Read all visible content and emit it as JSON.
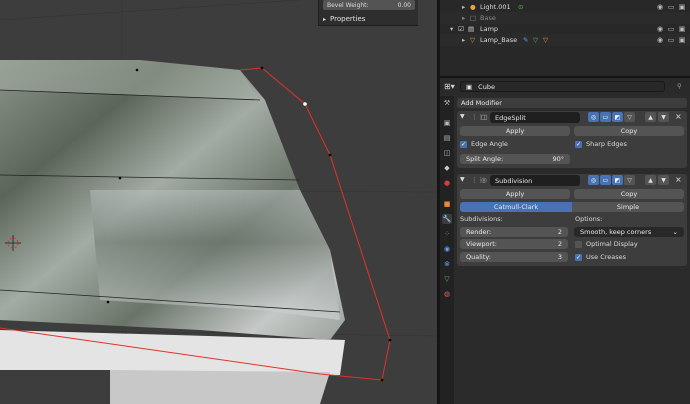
{
  "viewport": {
    "bevel_weight": {
      "label": "Bevel Weight:",
      "value": "0.00"
    },
    "properties_label": "Properties"
  },
  "outliner": {
    "rows": [
      {
        "name": "Light.001",
        "icon": "light-bulb-icon",
        "extra_icon": "light-data-icon",
        "color": "#f0a040"
      },
      {
        "name": "Base",
        "icon": "empty-icon",
        "dim": true
      },
      {
        "name": "Lamp",
        "icon": "collection-icon"
      },
      {
        "name": "Lamp_Base",
        "icon": "mesh-object-icon",
        "color": "#f0a040"
      }
    ]
  },
  "properties": {
    "object_name": "Cube",
    "add_modifier": "Add Modifier",
    "edge_split": {
      "name": "EdgeSplit",
      "apply": "Apply",
      "copy": "Copy",
      "edge_angle": "Edge Angle",
      "sharp_edges": "Sharp Edges",
      "split_angle_label": "Split Angle:",
      "split_angle_value": "90°"
    },
    "subdivision": {
      "name": "Subdivision",
      "apply": "Apply",
      "copy": "Copy",
      "catmull_clark": "Catmull-Clark",
      "simple": "Simple",
      "subdivisions_label": "Subdivisions:",
      "options_label": "Options:",
      "render_label": "Render:",
      "render_value": "2",
      "viewport_label": "Viewport:",
      "viewport_value": "2",
      "quality_label": "Quality:",
      "quality_value": "3",
      "uv_smooth": "Smooth, keep corners",
      "optimal_display": "Optimal Display",
      "use_creases": "Use Creases"
    }
  },
  "colors": {
    "accent": "#4772b3",
    "selection_edge": "#e0322a",
    "object_orange": "#f0a040"
  }
}
